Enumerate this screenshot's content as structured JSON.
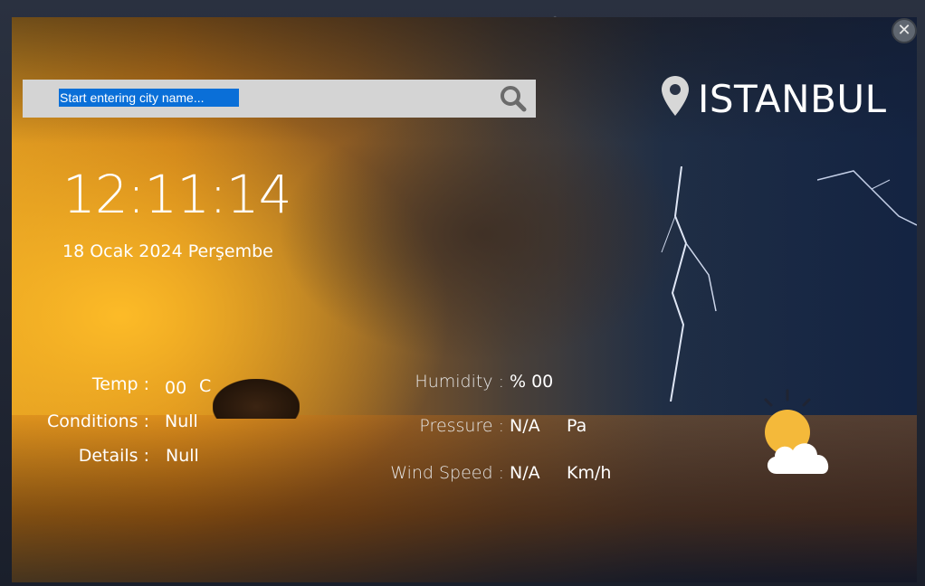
{
  "window": {
    "close_label": "✕"
  },
  "search": {
    "placeholder": "Start entering city name..."
  },
  "location": {
    "city": "ISTANBUL",
    "icon": "map-pin-icon"
  },
  "clock": {
    "time": "12:11:14",
    "date": "18 Ocak 2024 Perşembe"
  },
  "weather": {
    "temp_label": "Temp :",
    "temp_value": "00",
    "temp_unit": "C",
    "conditions_label": "Conditions :",
    "conditions_value": "Null",
    "details_label": "Details :",
    "details_value": "Null",
    "humidity_label": "Humidity :",
    "humidity_value": "% 00",
    "pressure_label": "Pressure :",
    "pressure_value": "N/A",
    "pressure_unit": "Pa",
    "wind_label": "Wind Speed :",
    "wind_value": "N/A",
    "wind_unit": "Km/h",
    "icon": "partly-cloudy-icon"
  },
  "colors": {
    "search_bg": "#d4d4d4",
    "selection": "#0a6fd8",
    "text": "#ffffff",
    "sun": "#f4b93a"
  }
}
